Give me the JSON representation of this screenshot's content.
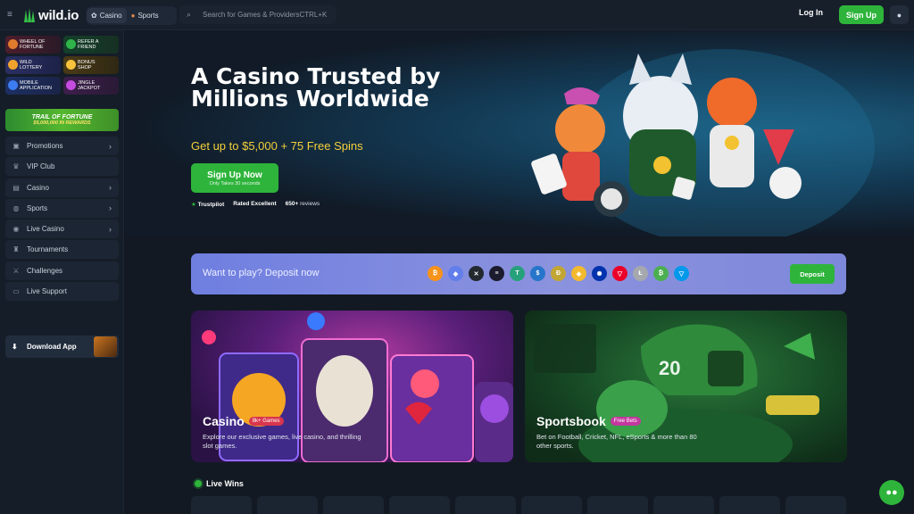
{
  "header": {
    "logo_text": "wild.io",
    "nav": [
      {
        "label": "Casino",
        "icon": "slot-icon"
      },
      {
        "label": "Sports",
        "icon": "football-icon"
      }
    ],
    "search_placeholder": "Search for Games & Providers",
    "search_shortcut": "CTRL+K",
    "login_label": "Log In",
    "signup_label": "Sign Up"
  },
  "sidebar": {
    "promos": [
      {
        "label_line1": "Wheel of",
        "label_line2": "Fortune"
      },
      {
        "label_line1": "Refer a",
        "label_line2": "Friend"
      },
      {
        "label_line1": "Wild",
        "label_line2": "Lottery"
      },
      {
        "label_line1": "Bonus",
        "label_line2": "Shop"
      },
      {
        "label_line1": "Mobile",
        "label_line2": "Application"
      },
      {
        "label_line1": "Jingle",
        "label_line2": "Jackpot"
      }
    ],
    "trail_title": "TRAIL OF FORTUNE",
    "trail_sub": "$5,000,000 IN REWARDS",
    "items": [
      {
        "label": "Promotions",
        "icon": "gift-icon",
        "chevron": true
      },
      {
        "label": "VIP Club",
        "icon": "crown-icon",
        "chevron": false
      },
      {
        "label": "Casino",
        "icon": "slot-icon",
        "chevron": true
      },
      {
        "label": "Sports",
        "icon": "ball-icon",
        "chevron": true
      },
      {
        "label": "Live Casino",
        "icon": "live-icon",
        "chevron": true
      },
      {
        "label": "Tournaments",
        "icon": "trophy-icon",
        "chevron": false
      },
      {
        "label": "Challenges",
        "icon": "swords-icon",
        "chevron": false
      },
      {
        "label": "Live Support",
        "icon": "chat-icon",
        "chevron": false
      }
    ],
    "download_label": "Download App"
  },
  "hero": {
    "title": "A Casino Trusted by Millions Worldwide",
    "subtitle": "Get up to $5,000 + 75 Free Spins",
    "cta_label": "Sign Up Now",
    "cta_sub": "Only Takes 30 seconds",
    "trustpilot": "Trustpilot",
    "rating": "Rated Excellent",
    "reviews_count": "650+",
    "reviews_label": "reviews"
  },
  "deposit": {
    "label": "Want to play? Deposit now",
    "button_label": "Deposit",
    "coins": [
      {
        "name": "bitcoin-icon",
        "symbol": "₿",
        "color": "#f7931a"
      },
      {
        "name": "ethereum-icon",
        "symbol": "◆",
        "color": "#627eea"
      },
      {
        "name": "xrp-icon",
        "symbol": "✕",
        "color": "#23292f"
      },
      {
        "name": "solana-icon",
        "symbol": "≡",
        "color": "#1b1b2e"
      },
      {
        "name": "tether-icon",
        "symbol": "T",
        "color": "#26a17b"
      },
      {
        "name": "usdc-icon",
        "symbol": "$",
        "color": "#2775ca"
      },
      {
        "name": "dogecoin-icon",
        "symbol": "Ð",
        "color": "#c2a633"
      },
      {
        "name": "bnb-icon",
        "symbol": "◈",
        "color": "#f3ba2f"
      },
      {
        "name": "cardano-icon",
        "symbol": "✺",
        "color": "#0033ad"
      },
      {
        "name": "tron-icon",
        "symbol": "▽",
        "color": "#eb0029"
      },
      {
        "name": "litecoin-icon",
        "symbol": "Ł",
        "color": "#a5a8ad"
      },
      {
        "name": "bitcoin-cash-icon",
        "symbol": "₿",
        "color": "#4caf50"
      },
      {
        "name": "toncoin-icon",
        "symbol": "▽",
        "color": "#0098ea"
      }
    ]
  },
  "cards": {
    "casino": {
      "title": "Casino",
      "badge": "8k+ Games",
      "desc": "Explore our exclusive games, live casino, and thrilling slot games."
    },
    "sports": {
      "title": "Sportsbook",
      "badge": "Free Bets",
      "desc": "Bet on Football, Cricket, NFL, eSports & more than 80 other sports."
    }
  },
  "live_wins": {
    "title": "Live Wins"
  },
  "colors": {
    "accent": "#2eb43b",
    "gold": "#f4d03a",
    "bg": "#121923"
  }
}
